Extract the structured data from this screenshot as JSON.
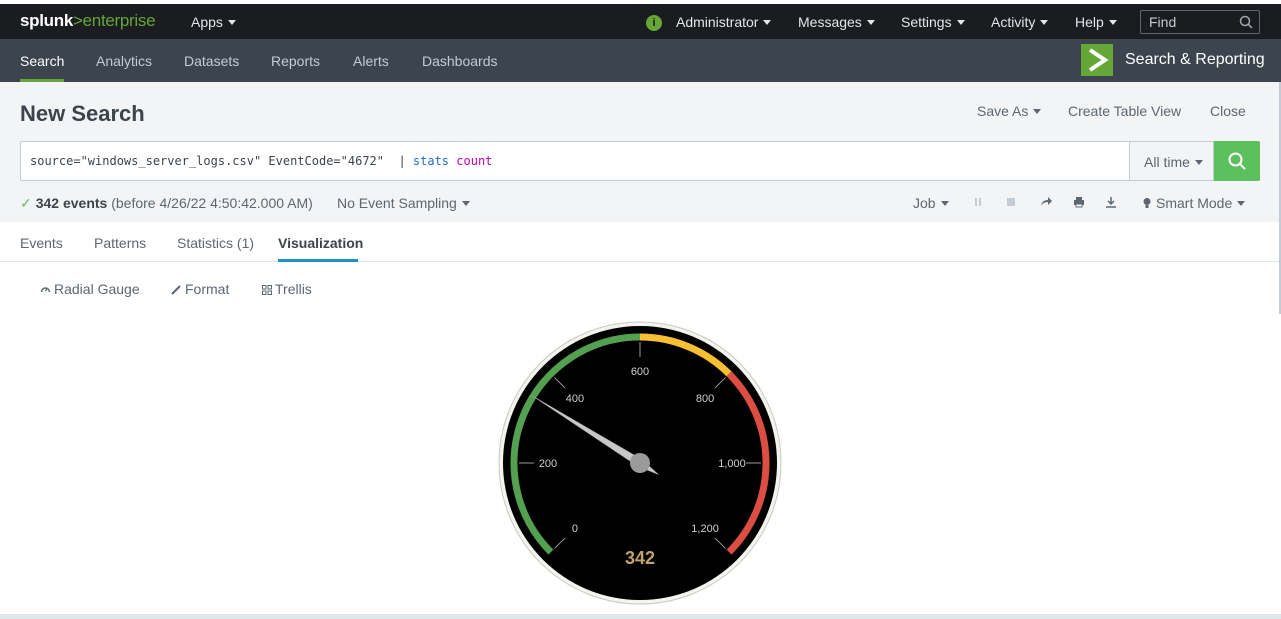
{
  "topbar": {
    "logo_prefix": "splunk",
    "logo_sep": ">",
    "logo_suffix": "enterprise",
    "apps": "Apps",
    "info_icon": "i",
    "administrator": "Administrator",
    "messages": "Messages",
    "settings": "Settings",
    "activity": "Activity",
    "help": "Help",
    "find_placeholder": "Find"
  },
  "appbar": {
    "nav": [
      "Search",
      "Analytics",
      "Datasets",
      "Reports",
      "Alerts",
      "Dashboards"
    ],
    "active": "Search",
    "app_title": "Search & Reporting"
  },
  "search": {
    "title": "New Search",
    "save_as": "Save As",
    "create_table_view": "Create Table View",
    "close": "Close",
    "query_base": "source=\"windows_server_logs.csv\" EventCode=\"4672\"  | ",
    "query_cmd": "stats",
    "query_fn": "count",
    "time_range": "All time"
  },
  "status": {
    "events": "342 events",
    "before": "(before 4/26/22 4:50:42.000 AM)",
    "sampling": "No Event Sampling",
    "job": "Job",
    "mode": "Smart Mode"
  },
  "tabs": [
    "Events",
    "Patterns",
    "Statistics (1)",
    "Visualization"
  ],
  "viz_toolbar": {
    "type": "Radial Gauge",
    "format": "Format",
    "trellis": "Trellis"
  },
  "gauge": {
    "value": 342,
    "value_label": "342",
    "min": 0,
    "max": 1200,
    "ticks": [
      "0",
      "200",
      "400",
      "600",
      "800",
      "1,000",
      "1,200"
    ],
    "ranges": [
      {
        "from": 0,
        "to": 600,
        "color": "#53a051"
      },
      {
        "from": 600,
        "to": 800,
        "color": "#f8be34"
      },
      {
        "from": 800,
        "to": 1200,
        "color": "#dc4e41"
      }
    ]
  },
  "colors": {
    "accent": "#65a637",
    "search_button": "#5cc05c",
    "tab_underline": "#1e93c6",
    "value_text": "#bfa56a"
  }
}
